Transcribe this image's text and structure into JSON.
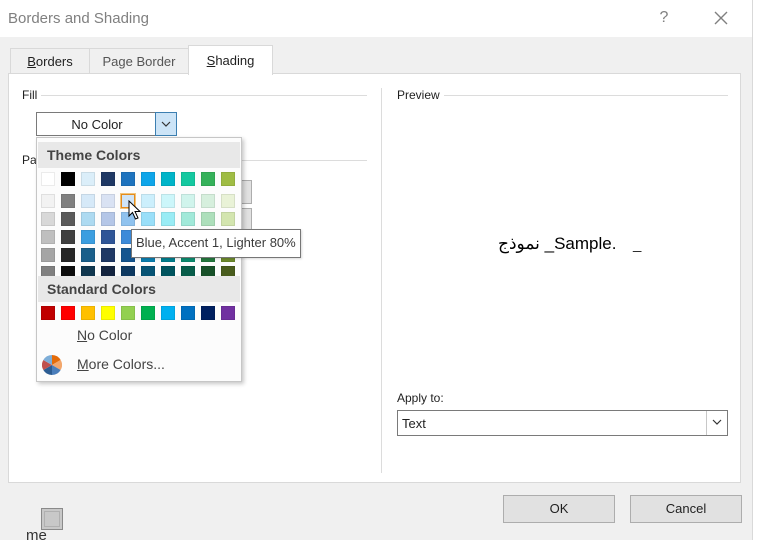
{
  "window": {
    "title": "Borders and Shading",
    "help_glyph": "?",
    "close_glyph": "✕"
  },
  "tabs": [
    {
      "label": "Borders",
      "accel": "B",
      "rest": "orders",
      "active": false
    },
    {
      "label": "Page Border",
      "active": false
    },
    {
      "label": "Shading",
      "accel": "S",
      "rest": "hading",
      "active": true
    }
  ],
  "fill": {
    "group_label": "Fill",
    "current_value": "No Color",
    "arrow_glyph": "⌵"
  },
  "pattern": {
    "group_label_partial": "Pa"
  },
  "dropdown": {
    "theme_header": "Theme Colors",
    "standard_header": "Standard Colors",
    "no_color_label": "No Color",
    "no_color_accel": "N",
    "no_color_rest": "o Color",
    "more_colors_label": "More Colors...",
    "more_colors_accel": "M",
    "more_colors_rest": "ore Colors...",
    "theme_top_row": [
      "#ffffff",
      "#000000",
      "#e7e6e6",
      "#44546a",
      "#4472c4",
      "#ed7d31",
      "#a5a5a5",
      "#ffc000",
      "#5b9bd5",
      "#70ad47"
    ],
    "theme_top_row_rendered": [
      "#ffffff",
      "#000000",
      "#dbeef9",
      "#1f3864",
      "#1e73be",
      "#0ea5e9",
      "#00b4c8",
      "#14c8a0",
      "#35b15a",
      "#9fbc44"
    ],
    "theme_shades": [
      [
        "#f2f2f2",
        "#7f7f7f",
        "#d6e9f8",
        "#d9e2f3",
        "#cfe4f7",
        "#cceffc",
        "#ccf6fa",
        "#d0f4ec",
        "#d6efdd",
        "#e9f2d7"
      ],
      [
        "#d8d8d8",
        "#595959",
        "#addaf1",
        "#b4c6e7",
        "#8fc2ee",
        "#99dff9",
        "#99ecf5",
        "#a1e9d9",
        "#addfbb",
        "#d3e5af"
      ],
      [
        "#bfbfbf",
        "#3f3f3f",
        "#3b9ee0",
        "#2f5597",
        "#3c8ad9",
        "#3fc4f2",
        "#33dbe9",
        "#4fd5b5",
        "#6ac986",
        "#b8d27a"
      ],
      [
        "#a5a5a5",
        "#262626",
        "#1a5f8a",
        "#1f3864",
        "#15558f",
        "#0b7fb0",
        "#007f8e",
        "#0c8c70",
        "#24793e",
        "#6d8a2c"
      ],
      [
        "#7f7f7f",
        "#0c0c0c",
        "#10374f",
        "#14243f",
        "#0e3961",
        "#075475",
        "#00545e",
        "#085d4a",
        "#185129",
        "#495c1d"
      ]
    ],
    "standard_colors": [
      "#c00000",
      "#ff0000",
      "#ffc000",
      "#ffff00",
      "#92d050",
      "#00b050",
      "#00b0f0",
      "#0070c0",
      "#002060",
      "#7030a0"
    ],
    "hover_index": {
      "row": 0,
      "col": 4
    }
  },
  "tooltip": {
    "text": "Blue, Accent 1, Lighter 80%"
  },
  "preview": {
    "group_label": "Preview",
    "sample_text": "نموذج _Sample.",
    "trailing_mark": "_",
    "apply_label": "Apply to:",
    "apply_value": "Text",
    "arrow_glyph": "⌵"
  },
  "buttons": {
    "ok": "OK",
    "cancel": "Cancel"
  },
  "background_fragments": {
    "frag_me": "me"
  }
}
